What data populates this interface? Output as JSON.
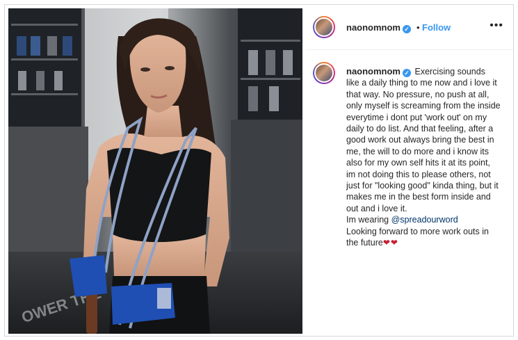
{
  "post": {
    "username": "naonomnom",
    "separator": "•",
    "follow_label": "Follow",
    "more_icon": "more-horizontal-icon",
    "verified_icon": "verified-badge-icon",
    "caption_intro": "Exercising sounds like a daily thing to me now and i love it that way. No pressure, no push at all, only myself is screaming from the inside everytime i dont put 'work out' on my daily to do list. And that feeling, after a good work out always bring the best in me, the will to do more and i know its also for my own self hits it at its point, im not doing this to please others, not just for \"looking good\" kinda thing, but it makes me in the best form inside and out and i love it.",
    "wearing_prefix": "Im wearing ",
    "mention": "@spreadourword",
    "closing": "Looking forward to more work outs in the future",
    "hearts": "❤❤"
  },
  "colors": {
    "link_blue": "#3897f0",
    "text": "#262626",
    "mention": "#003569",
    "heart": "#c62134"
  }
}
